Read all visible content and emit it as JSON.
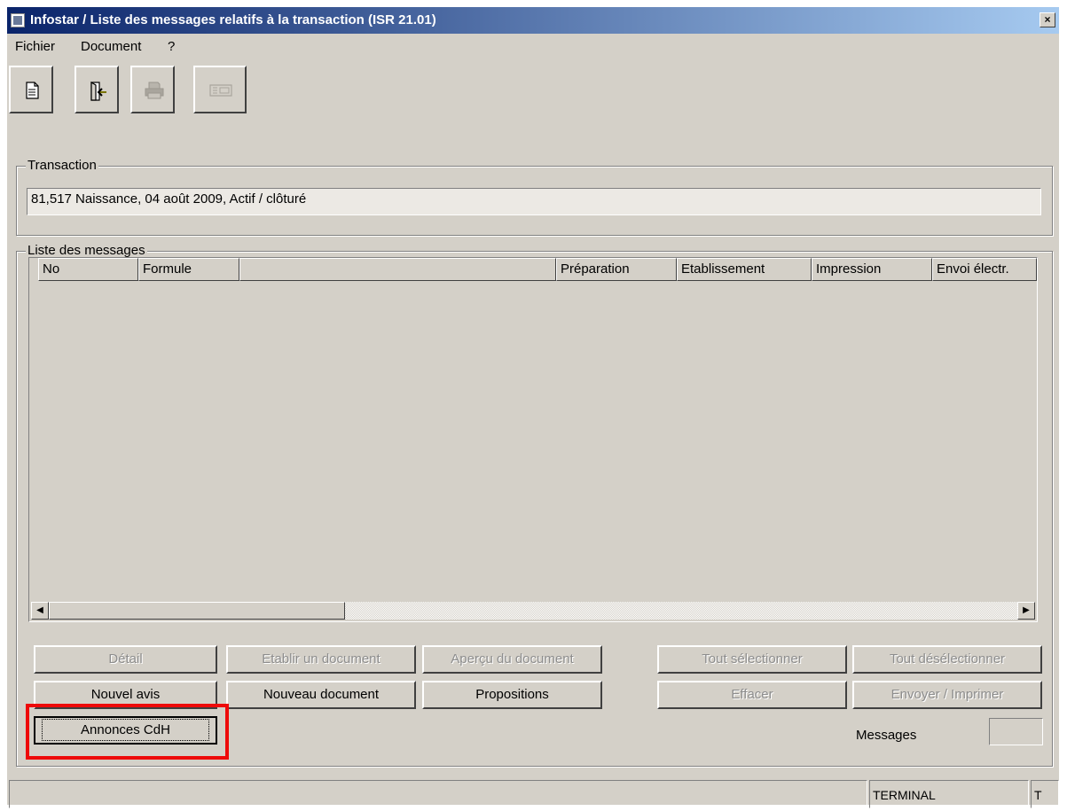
{
  "window": {
    "title": "Infostar / Liste des messages relatifs à la transaction (ISR 21.01)",
    "close_label": "×"
  },
  "menu": [
    {
      "label": "Fichier"
    },
    {
      "label": "Document"
    },
    {
      "label": "?"
    }
  ],
  "toolbar": [
    {
      "icon": "document-icon",
      "enabled": true
    },
    {
      "icon": "exit-door-icon",
      "enabled": true
    },
    {
      "icon": "printer-icon",
      "enabled": false
    },
    {
      "icon": "envelope-icon",
      "enabled": false
    }
  ],
  "transaction": {
    "group_label": "Transaction",
    "value": "81,517  Naissance, 04 août 2009, Actif / clôturé"
  },
  "messages": {
    "group_label": "Liste des messages",
    "columns": [
      "No",
      "Formule",
      "",
      "Préparation",
      "Etablissement",
      "Impression",
      "Envoi électr."
    ],
    "rows": []
  },
  "buttons": {
    "detail": "Détail",
    "etablir": "Etablir un document",
    "apercu": "Aperçu du document",
    "tout_selectionner": "Tout sélectionner",
    "tout_deselectionner": "Tout désélectionner",
    "nouvel_avis": "Nouvel avis",
    "nouveau_document": "Nouveau document",
    "propositions": "Propositions",
    "effacer": "Effacer",
    "envoyer": "Envoyer / Imprimer",
    "annonces": "Annonces CdH"
  },
  "messages_count": {
    "label": "Messages",
    "value": ""
  },
  "status": {
    "message": "",
    "terminal": "TERMINAL",
    "mode": "T"
  },
  "colors": {
    "title_gradient_start": "#0a246a",
    "title_gradient_end": "#a6caf0",
    "window_bg": "#d4d0c8",
    "highlight": "#ee0a0a"
  }
}
